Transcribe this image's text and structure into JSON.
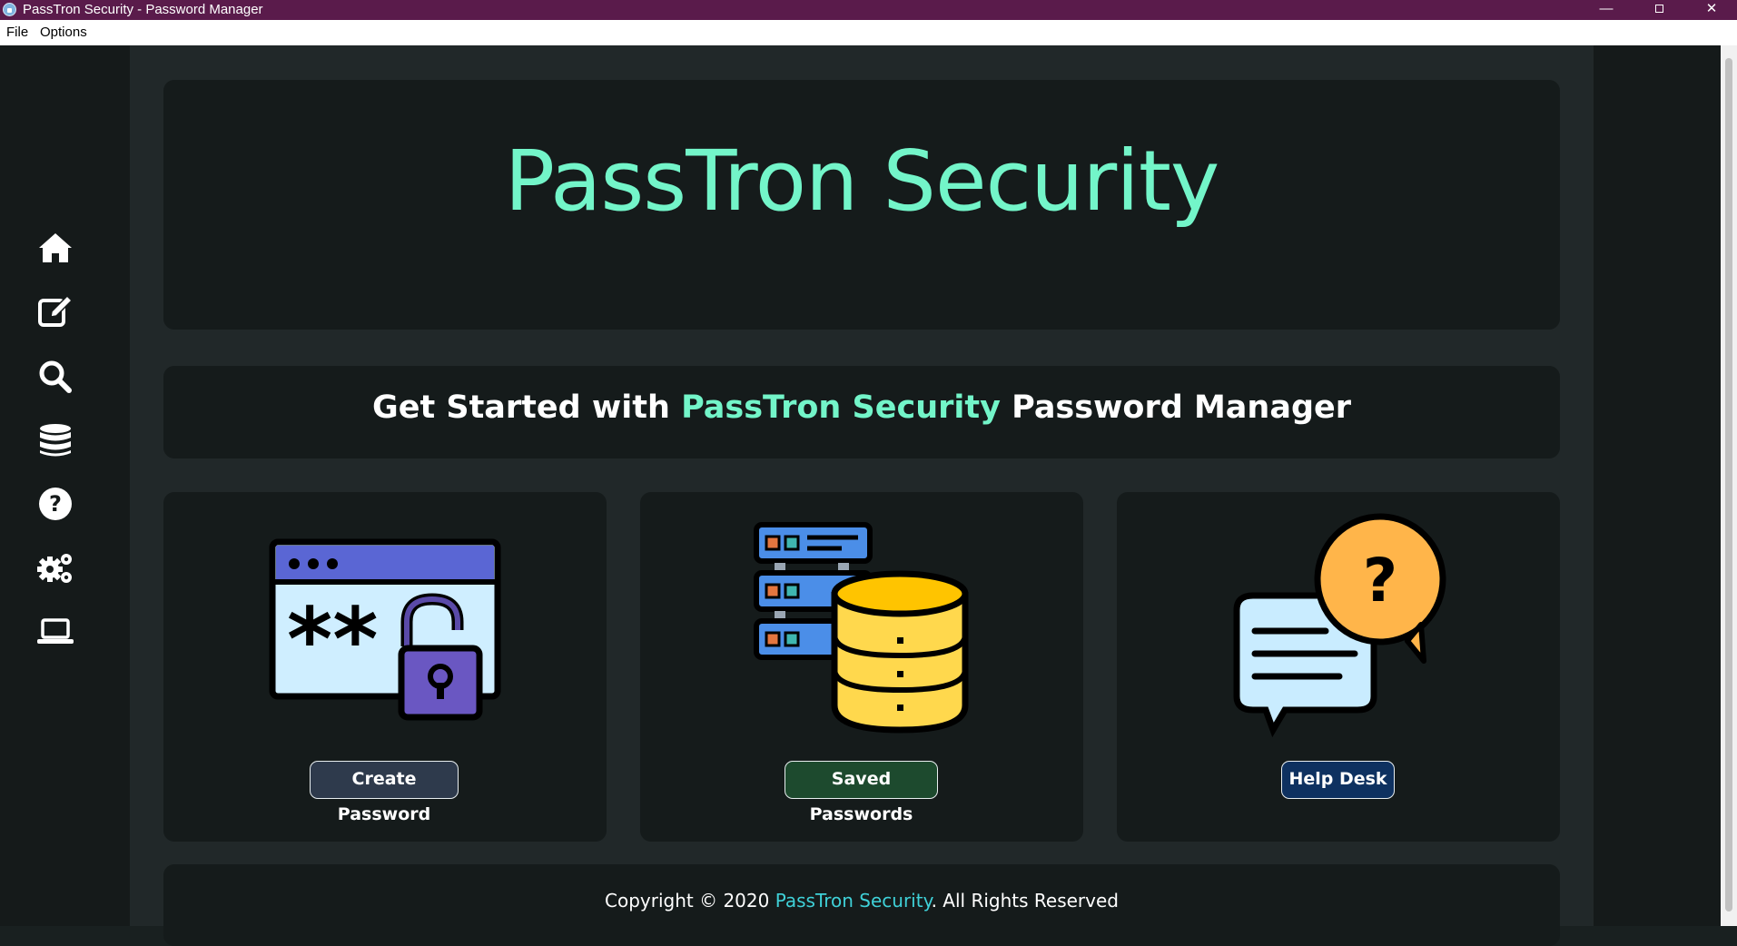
{
  "window": {
    "title": "PassTron Security - Password Manager",
    "controls": {
      "minimize": "—",
      "close": "✕"
    }
  },
  "menubar": {
    "file": "File",
    "options": "Options"
  },
  "sidebar": {
    "items": [
      {
        "icon": "home-icon"
      },
      {
        "icon": "edit-icon"
      },
      {
        "icon": "search-icon"
      },
      {
        "icon": "database-icon"
      },
      {
        "icon": "help-icon"
      },
      {
        "icon": "gears-icon"
      },
      {
        "icon": "laptop-icon"
      }
    ]
  },
  "hero": {
    "title": "PassTron Security"
  },
  "get_started": {
    "prefix": "Get Started with ",
    "brand": "PassTron Security",
    "suffix": " Password Manager"
  },
  "cards": [
    {
      "icon": "password-lock-icon",
      "button": "Create Password"
    },
    {
      "icon": "server-database-icon",
      "button": "Saved Passwords"
    },
    {
      "icon": "chat-help-icon",
      "button": "Help Desk"
    }
  ],
  "footer": {
    "prefix": "Copyright © 2020 ",
    "brand": "PassTron Security",
    "suffix": ". All Rights Reserved"
  },
  "colors": {
    "titlebar": "#5a1b4b",
    "accent": "#73f5c9",
    "footer_brand": "#3fd1d8",
    "panel": "#151b1b",
    "main_bg": "#212829"
  }
}
